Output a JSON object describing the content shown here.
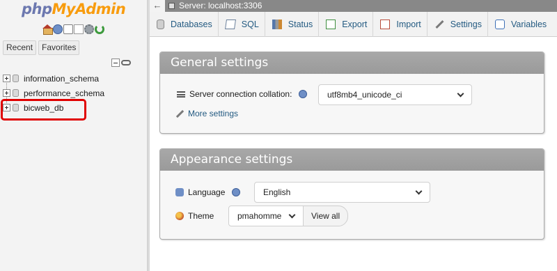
{
  "app": {
    "logo": {
      "php": "php",
      "my": "My",
      "admin": "Admin"
    }
  },
  "sidebar": {
    "icons": [
      "home-icon",
      "logout-icon",
      "docs-icon",
      "mysql-docs-icon",
      "settings-gear-icon",
      "reload-icon"
    ],
    "recent_label": "Recent",
    "favorites_label": "Favorites",
    "databases": [
      {
        "name": "information_schema"
      },
      {
        "name": "performance_schema"
      },
      {
        "name": "bicweb_db"
      }
    ],
    "highlight_color": "#e00000"
  },
  "server_bar": {
    "back_glyph": "←",
    "label": "Server: localhost:3306"
  },
  "top_menu": {
    "tabs": [
      {
        "label": "Databases",
        "icon": "database-icon"
      },
      {
        "label": "SQL",
        "icon": "sql-icon"
      },
      {
        "label": "Status",
        "icon": "status-icon"
      },
      {
        "label": "Export",
        "icon": "export-icon"
      },
      {
        "label": "Import",
        "icon": "import-icon"
      },
      {
        "label": "Settings",
        "icon": "wrench-icon"
      },
      {
        "label": "Variables",
        "icon": "variables-icon"
      }
    ]
  },
  "general_settings": {
    "title": "General settings",
    "collation_label": "Server connection collation:",
    "collation_value": "utf8mb4_unicode_ci",
    "more_settings": "More settings"
  },
  "appearance_settings": {
    "title": "Appearance settings",
    "language_label": "Language",
    "language_value": "English",
    "theme_label": "Theme",
    "theme_value": "pmahomme",
    "view_all": "View all"
  },
  "colors": {
    "link_blue": "#235a81",
    "panel_header": "#9f9f9f",
    "server_bar": "#888888"
  }
}
